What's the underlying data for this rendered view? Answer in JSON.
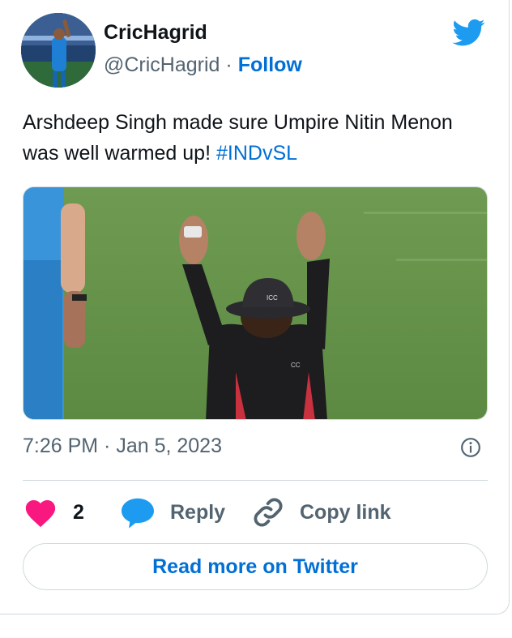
{
  "author": {
    "name": "CricHagrid",
    "handle": "@CricHagrid",
    "separator": "·",
    "follow_label": "Follow"
  },
  "tweet": {
    "text": "Arshdeep Singh made sure Umpire Nitin Menon was well warmed up! ",
    "hashtag": "#INDvSL"
  },
  "media": {
    "hat_badge": "ICC",
    "shirt_logo": "CC"
  },
  "meta": {
    "time": "7:26 PM · Jan 5, 2023"
  },
  "actions": {
    "like_count": "2",
    "reply_label": "Reply",
    "copy_label": "Copy link"
  },
  "footer": {
    "read_more_label": "Read more on Twitter"
  },
  "colors": {
    "accent": "#006fd6",
    "like": "#f91880",
    "reply_icon": "#1d9bf0",
    "twitter_bird": "#1d9bf0"
  },
  "icons": [
    "twitter-bird-icon",
    "info-icon",
    "heart-icon",
    "reply-bubble-icon",
    "link-icon"
  ]
}
